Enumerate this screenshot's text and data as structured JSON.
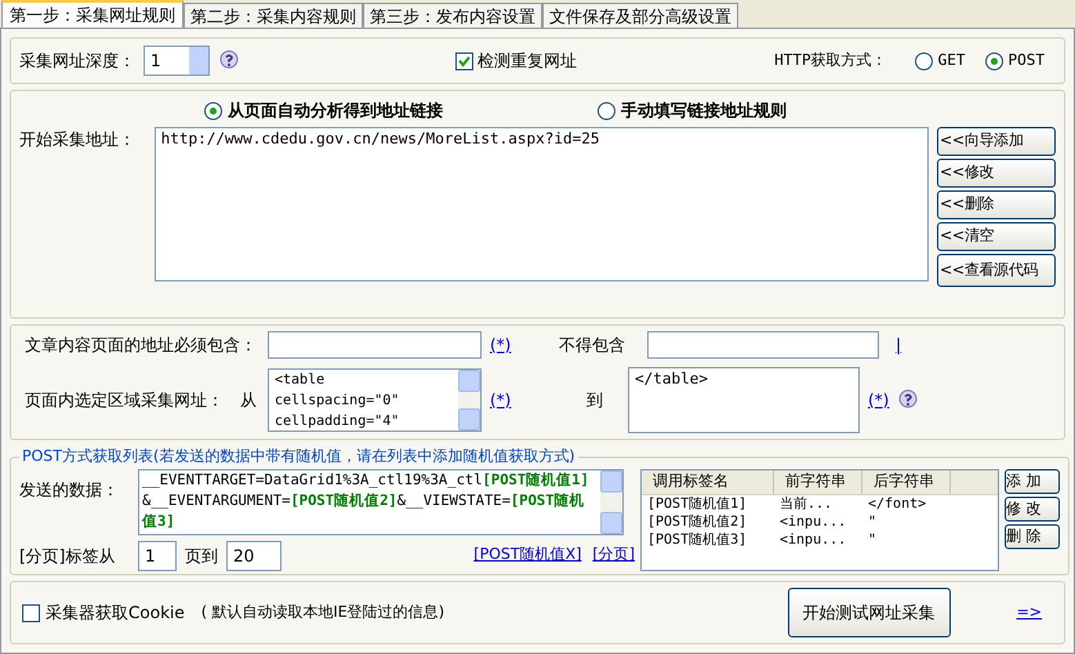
{
  "tabs": [
    {
      "label": "第一步：采集网址规则",
      "selected": true
    },
    {
      "label": "第二步：采集内容规则",
      "selected": false
    },
    {
      "label": "第三步：发布内容设置",
      "selected": false
    },
    {
      "label": "文件保存及部分高级设置",
      "selected": false
    }
  ],
  "depth": {
    "label": "采集网址深度：",
    "value": "1"
  },
  "check_duplicate": {
    "label": "检测重复网址",
    "checked": true
  },
  "http_method": {
    "label": "HTTP获取方式：",
    "options": [
      {
        "label": "GET",
        "selected": false
      },
      {
        "label": "POST",
        "selected": true
      }
    ]
  },
  "source_mode": [
    {
      "label": "从页面自动分析得到地址链接",
      "selected": true
    },
    {
      "label": "手动填写链接地址规则",
      "selected": false
    }
  ],
  "start_urls": {
    "label": "开始采集地址：",
    "value": "http://www.cdedu.gov.cn/news/MoreList.aspx?id=25"
  },
  "url_buttons": [
    "<<向导添加",
    "<<修改",
    "<<删除",
    "<<清空",
    "<<查看源代码"
  ],
  "must_contain": {
    "label": "文章内容页面的地址必须包含：",
    "link": "(*)"
  },
  "not_contain": {
    "label": "不得包含",
    "link": "|"
  },
  "region": {
    "label": "页面内选定区域采集网址：",
    "from_label": "从",
    "from_value": "<table\ncellspacing=\"0\"\ncellpadding=\"4\"",
    "from_link": "(*)",
    "to_label": "到",
    "to_value": "</table>",
    "to_link": "(*)"
  },
  "post": {
    "title": "POST方式获取列表(若发送的数据中带有随机值，请在列表中添加随机值获取方式)",
    "data_label": "发送的数据：",
    "data": "__EVENTTARGET=DataGrid1%3A_ctl19%3A_ctl**[POST随机值1]**&__EVENTARGUMENT=**[POST随机值2]**&__VIEWSTATE=**[POST随机值3]**",
    "page_label": "[分页]标签从",
    "page_from": "1",
    "page_to_label": "页到",
    "page_to": "20",
    "links": [
      "[POST随机值X]",
      "[分页]"
    ],
    "table": {
      "columns": [
        "调用标签名",
        "前字符串",
        "后字符串"
      ],
      "rows": [
        [
          "[POST随机值1]",
          "当前...",
          "</font>"
        ],
        [
          "[POST随机值2]",
          "<inpu...",
          "\""
        ],
        [
          "[POST随机值3]",
          "<inpu...",
          "\""
        ]
      ]
    },
    "buttons": [
      "添 加",
      "修 改",
      "删 除"
    ]
  },
  "cookie": {
    "label": "采集器获取Cookie",
    "checked": false,
    "note": "( 默认自动读取本地IE登陆过的信息)"
  },
  "test_button": "开始测试网址采集",
  "more_link": "=>"
}
